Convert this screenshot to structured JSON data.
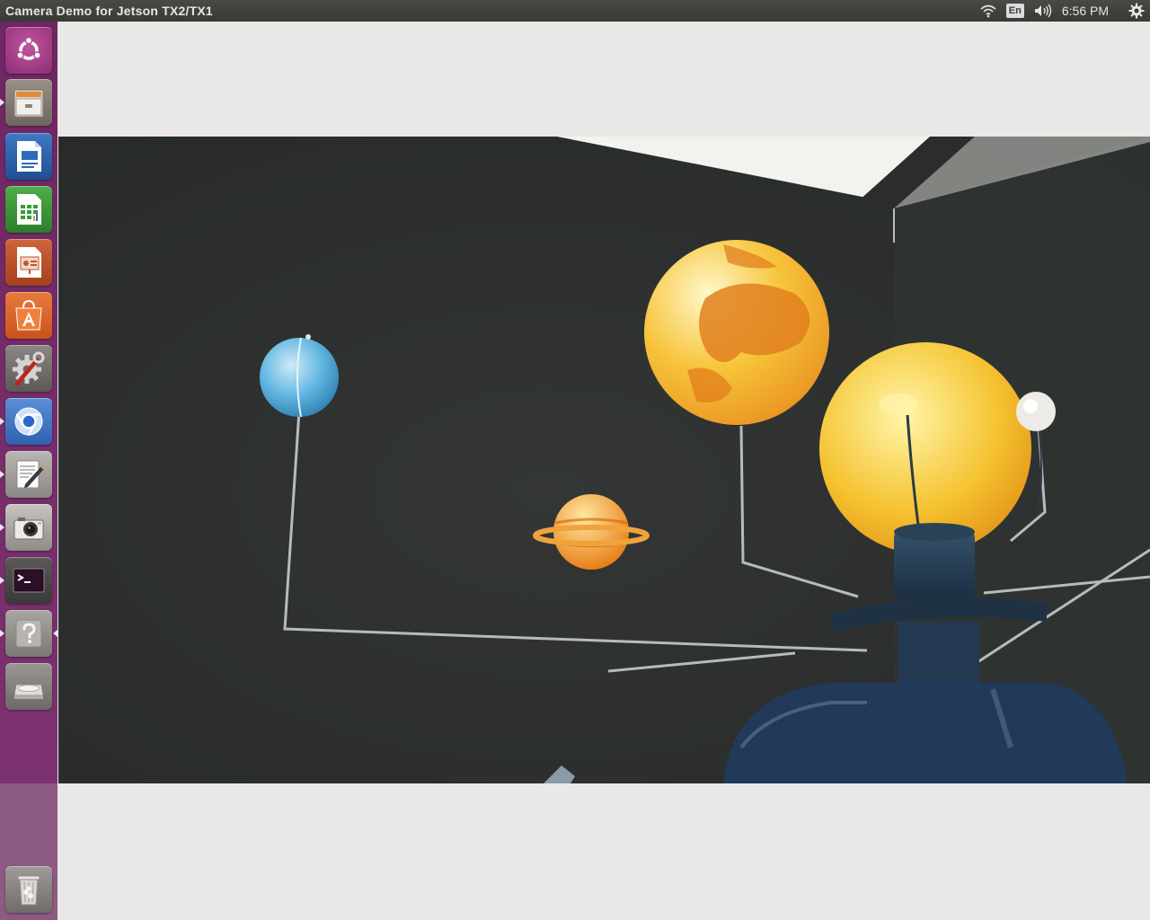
{
  "window": {
    "title": "Camera Demo for Jetson TX2/TX1"
  },
  "indicators": {
    "network_icon": "wifi-icon",
    "keyboard_layout": "En",
    "sound_icon": "speaker-icon",
    "clock": "6:56 PM",
    "session_icon": "gear-icon"
  },
  "launcher": {
    "items": [
      {
        "name": "ubuntu-dash",
        "icon": "ubuntu-logo-icon",
        "running": false
      },
      {
        "name": "files",
        "icon": "file-cabinet-icon",
        "running": true
      },
      {
        "name": "libreoffice-writer",
        "icon": "writer-icon",
        "running": false
      },
      {
        "name": "libreoffice-calc",
        "icon": "calc-icon",
        "running": false
      },
      {
        "name": "libreoffice-impress",
        "icon": "impress-icon",
        "running": false
      },
      {
        "name": "software-center",
        "icon": "shopping-bag-icon",
        "running": false
      },
      {
        "name": "system-settings",
        "icon": "settings-wrench-icon",
        "running": false
      },
      {
        "name": "chromium",
        "icon": "chromium-icon",
        "running": true
      },
      {
        "name": "text-editor",
        "icon": "text-editor-icon",
        "running": true
      },
      {
        "name": "camera-app",
        "icon": "camera-icon",
        "running": true
      },
      {
        "name": "terminal",
        "icon": "terminal-icon",
        "running": true
      },
      {
        "name": "help",
        "icon": "help-icon",
        "running": true,
        "focused": true
      },
      {
        "name": "drive",
        "icon": "disk-drive-icon",
        "running": false
      },
      {
        "name": "trash",
        "icon": "trash-icon",
        "running": false
      }
    ],
    "colors": {
      "bg": "#7b2f6b"
    }
  },
  "camera_view": {
    "description_icon": "camera-feed"
  }
}
